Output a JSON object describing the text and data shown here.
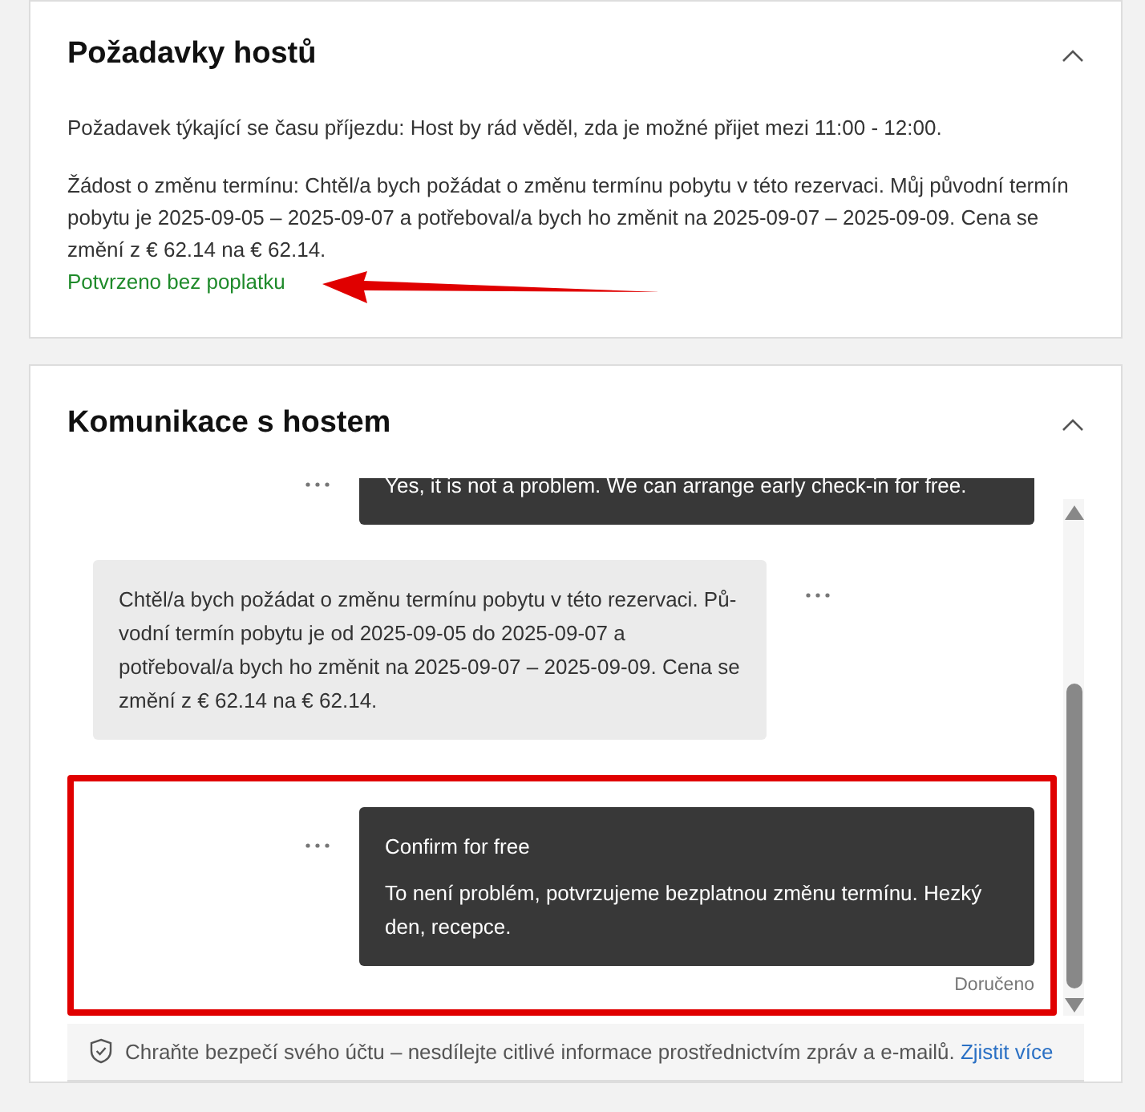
{
  "requests_card": {
    "title": "Požadavky hostů",
    "expanded": true,
    "items": [
      {
        "text": "Požadavek týkající se času příjezdu: Host by rád věděl, zda je možné přijet mezi 11:00 - 12:00."
      },
      {
        "text": "Žádost o změnu termínu: Chtěl/a bych požádat o změnu termínu pobytu v této rezervaci. Můj původní termín pobytu je 2025-09-05 – 2025-09-07 a potřeboval/a bych ho změnit na 2025-09-07 – 2025-09-09. Cena se změní z € 62.14 na € 62.14.",
        "status": "Potvrzeno bez poplatku",
        "annotated": true
      }
    ]
  },
  "chat_card": {
    "title": "Komunikace s hostem",
    "expanded": true,
    "messages": [
      {
        "kind": "outgoing",
        "text": "Yes, it is not a problem. We can arrange early check-in for free.",
        "highlighted": false
      },
      {
        "kind": "incoming",
        "text": "Chtěl/a bych požádat o změnu termínu pobytu v této rezervaci. Pů-vodní termín pobytu je od 2025-09-05 do 2025-09-07 a potřeboval/a bych ho změnit na 2025-09-07 – 2025-09-09. Cena se změní z € 62.14 na € 62.14.",
        "highlighted": false
      },
      {
        "kind": "outgoing",
        "title": "Confirm for free",
        "text": "To není problém, potvrzujeme bezplatnou změnu termínu. Hezký den, recepce.",
        "status": "Doručeno",
        "highlighted": true
      }
    ],
    "notice": {
      "text": "Chraňte bezpečí svého účtu – nesdílejte citlivé informace prostřednictvím zpráv a e-mailů.",
      "link": "Zjistit více"
    }
  }
}
